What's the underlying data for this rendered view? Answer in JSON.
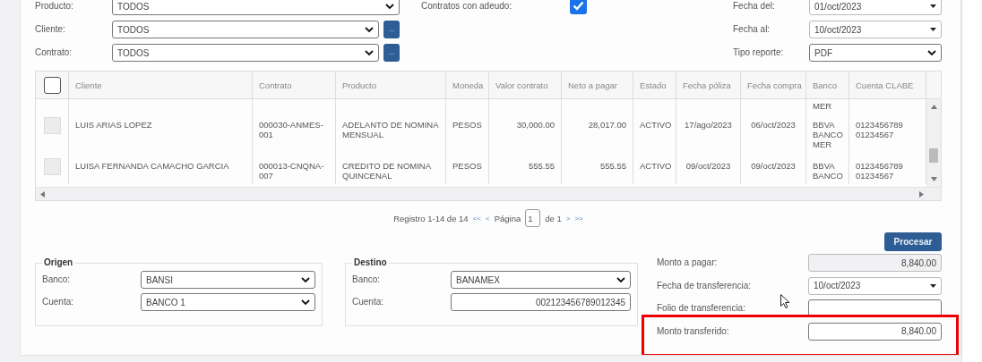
{
  "filters": {
    "producto": {
      "label": "Producto:",
      "value": "TODOS"
    },
    "cliente": {
      "label": "Cliente:",
      "value": "TODOS",
      "button": "..."
    },
    "contrato": {
      "label": "Contrato:",
      "value": "TODOS",
      "button": "..."
    },
    "con_adeudo": {
      "label": "Contratos con adeudo:",
      "checked": true
    },
    "fecha_del": {
      "label": "Fecha del:",
      "value": "01/oct/2023"
    },
    "fecha_al": {
      "label": "Fecha al:",
      "value": "10/oct/2023"
    },
    "tipo_reporte": {
      "label": "Tipo reporte:",
      "value": "PDF"
    }
  },
  "table": {
    "select_all_checked": false,
    "columns": [
      "Cliente",
      "Contrato",
      "Producto",
      "Moneda",
      "Valor contrato",
      "Neto a pagar",
      "Estado",
      "Fecha póliza",
      "Fecha compra",
      "Banco",
      "Cuenta CLABE"
    ],
    "rows": [
      {
        "banco": "MER"
      },
      {
        "checked": false,
        "cliente": "LUIS ARIAS LOPEZ",
        "contrato": "000030-ANMES-001",
        "producto": "ADELANTO DE NOMINA MENSUAL",
        "moneda": "PESOS",
        "valor": "30,000.00",
        "neto": "28,017.00",
        "estado": "ACTIVO",
        "fecha_poliza": "17/ago/2023",
        "fecha_compra": "06/oct/2023",
        "banco": "BBVA BANCO MER",
        "cuenta": "0123456789 01234567"
      },
      {
        "checked": false,
        "cliente": "LUISA FERNANDA CAMACHO GARCIA",
        "contrato": "000013-CNQNA-007",
        "producto": "CREDITO DE NOMINA QUINCENAL",
        "moneda": "PESOS",
        "valor": "555.55",
        "neto": "555.55",
        "estado": "ACTIVO",
        "fecha_poliza": "09/oct/2023",
        "fecha_compra": "09/oct/2023",
        "banco": "BBVA BANCO",
        "cuenta": "0123456789 01234567"
      }
    ]
  },
  "pagination": {
    "summary": "Registro 1-14 de 14",
    "first": "<<",
    "prev": "<",
    "page_label": "Página",
    "page": "1",
    "of": "de 1",
    "next": ">",
    "last": ">>"
  },
  "origen": {
    "title": "Origen",
    "banco_label": "Banco:",
    "banco": "BANSI",
    "cuenta_label": "Cuenta:",
    "cuenta": "BANCO 1"
  },
  "destino": {
    "title": "Destino",
    "banco_label": "Banco:",
    "banco": "BANAMEX",
    "cuenta_label": "Cuenta:",
    "cuenta": "002123456789012345"
  },
  "process_button": "Procesar",
  "transfer": [
    {
      "kind": "readonly",
      "label": "Monto a pagar:",
      "value": "8,840.00",
      "highlighted": false
    },
    {
      "kind": "date",
      "label": "Fecha de transferencia:",
      "value": "10/oct/2023",
      "highlighted": false
    },
    {
      "kind": "text",
      "label": "Folio de transferencia:",
      "highlighted": false
    },
    {
      "kind": "amount",
      "label": "Monto transferido:",
      "value": "8,840.00",
      "highlighted": true
    }
  ]
}
